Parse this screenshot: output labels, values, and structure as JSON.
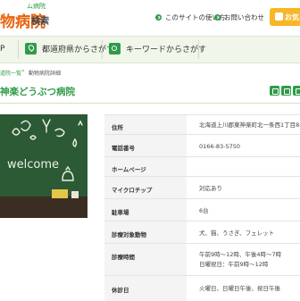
{
  "header": {
    "logo_small": "ム病院",
    "logo_main": "物病院",
    "logo_suffix": "検索",
    "links": [
      "このサイトの使い方",
      "お問い合わせ"
    ],
    "fav_label": "お気に"
  },
  "nav": {
    "top": "P",
    "items": [
      "都道府県からさがす",
      "キーワードからさがす"
    ]
  },
  "breadcrumb": {
    "items": [
      "道院一覧",
      "動物病院詳細"
    ],
    "separator": "»"
  },
  "page": {
    "title": "神楽どうぶつ病院"
  },
  "photo": {
    "board_text": "welcome"
  },
  "details": [
    {
      "label": "住所",
      "value": [
        "北海道上川郡東神楽町北一条西1丁目8-6"
      ]
    },
    {
      "label": "電話番号",
      "value": [
        "0166-83-5750"
      ]
    },
    {
      "label": "ホームページ",
      "value": [
        ""
      ]
    },
    {
      "label": "マイクロチップ",
      "value": [
        "対応あり"
      ]
    },
    {
      "label": "駐車場",
      "value": [
        "6台"
      ]
    },
    {
      "label": "診療対象動物",
      "value": [
        "犬、猫、うさぎ、フェレット"
      ]
    },
    {
      "label": "診療時間",
      "value": [
        "午前9時〜12時、午後4時〜7時",
        "日曜祝日：午前9時〜12時"
      ]
    },
    {
      "label": "休診日",
      "value": [
        "火曜日、日曜日午後、祝日午後"
      ]
    }
  ]
}
